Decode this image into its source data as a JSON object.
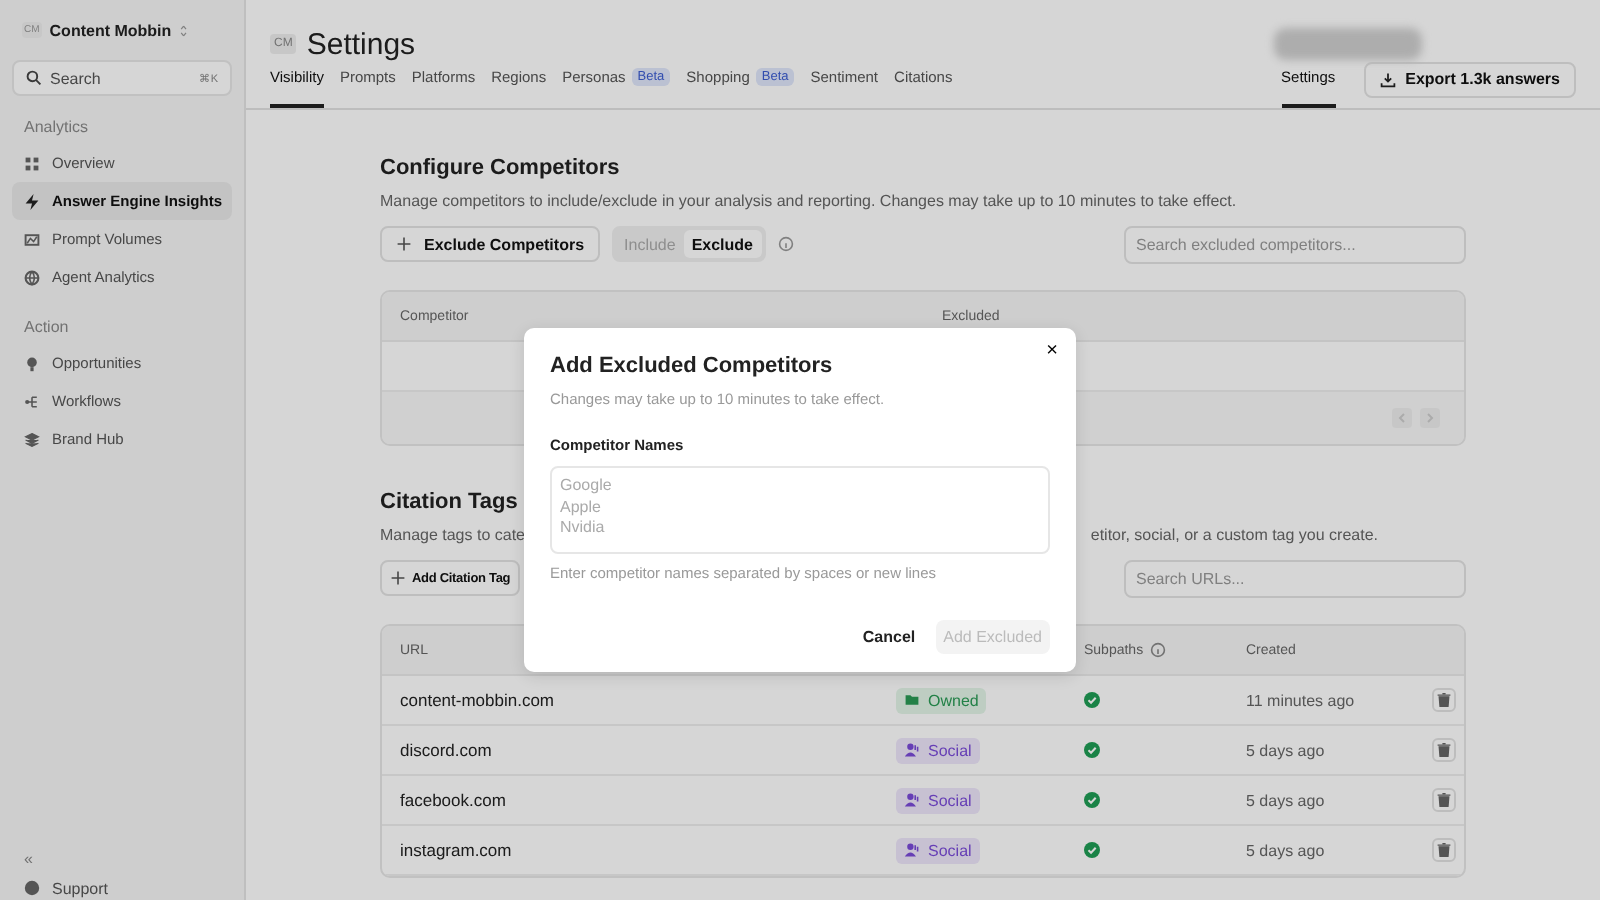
{
  "sidebar": {
    "workspace": {
      "badge": "CM",
      "name": "Content Mobbin"
    },
    "search": {
      "placeholder": "Search",
      "shortcut": "⌘K"
    },
    "sections": [
      {
        "label": "Analytics",
        "items": [
          {
            "label": "Overview",
            "selected": false
          },
          {
            "label": "Answer Engine Insights",
            "selected": true
          },
          {
            "label": "Prompt Volumes",
            "selected": false
          },
          {
            "label": "Agent Analytics",
            "selected": false
          }
        ]
      },
      {
        "label": "Action",
        "items": [
          {
            "label": "Opportunities",
            "selected": false
          },
          {
            "label": "Workflows",
            "selected": false
          },
          {
            "label": "Brand Hub",
            "selected": false
          }
        ]
      }
    ],
    "collapse": "«",
    "footer": [
      {
        "label": "Support"
      }
    ]
  },
  "header": {
    "badge": "CM",
    "title": "Settings"
  },
  "tabs": [
    {
      "label": "Visibility",
      "selected": true
    },
    {
      "label": "Prompts",
      "selected": false
    },
    {
      "label": "Platforms",
      "selected": false
    },
    {
      "label": "Regions",
      "selected": false
    },
    {
      "label": "Personas",
      "badge": "Beta",
      "selected": false
    },
    {
      "label": "Shopping",
      "badge": "Beta",
      "selected": false
    },
    {
      "label": "Sentiment",
      "selected": false
    },
    {
      "label": "Citations",
      "selected": false
    }
  ],
  "right_tabs": [
    {
      "label": "Settings",
      "selected": true
    }
  ],
  "export_button": "Export 1.3k answers",
  "competitors": {
    "title": "Configure Competitors",
    "description": "Manage competitors to include/exclude in your analysis and reporting. Changes may take up to 10 minutes to take effect.",
    "add_button": "Exclude Competitors",
    "toggle": [
      {
        "label": "Include",
        "selected": false
      },
      {
        "label": "Exclude",
        "selected": true
      }
    ],
    "search": {
      "placeholder": "Search excluded competitors..."
    },
    "columns": [
      "Competitor",
      "Excluded"
    ]
  },
  "citation_tags": {
    "title": "Citation Tags",
    "description_parts": [
      "Manage tags to cate",
      "etitor, social, or a custom tag you create."
    ],
    "add_button": "Add Citation Tag",
    "search": {
      "placeholder": "Search URLs..."
    },
    "columns": [
      "URL",
      "Subpaths",
      "Created"
    ],
    "rows": [
      {
        "url": "content-mobbin.com",
        "tag": {
          "label": "Owned",
          "kind": "owned"
        },
        "subpaths": true,
        "created": "11 minutes ago"
      },
      {
        "url": "discord.com",
        "tag": {
          "label": "Social",
          "kind": "social"
        },
        "subpaths": true,
        "created": "5 days ago"
      },
      {
        "url": "facebook.com",
        "tag": {
          "label": "Social",
          "kind": "social"
        },
        "subpaths": true,
        "created": "5 days ago"
      },
      {
        "url": "instagram.com",
        "tag": {
          "label": "Social",
          "kind": "social"
        },
        "subpaths": true,
        "created": "5 days ago"
      }
    ]
  },
  "modal": {
    "title": "Add Excluded Competitors",
    "description": "Changes may take up to 10 minutes to take effect.",
    "field_label": "Competitor Names",
    "placeholder": "Google\nApple\nNvidia",
    "hint": "Enter competitor names separated by spaces or new lines",
    "cancel": "Cancel",
    "submit": {
      "label": "Add Excluded",
      "disabled": true
    },
    "close": "×"
  }
}
